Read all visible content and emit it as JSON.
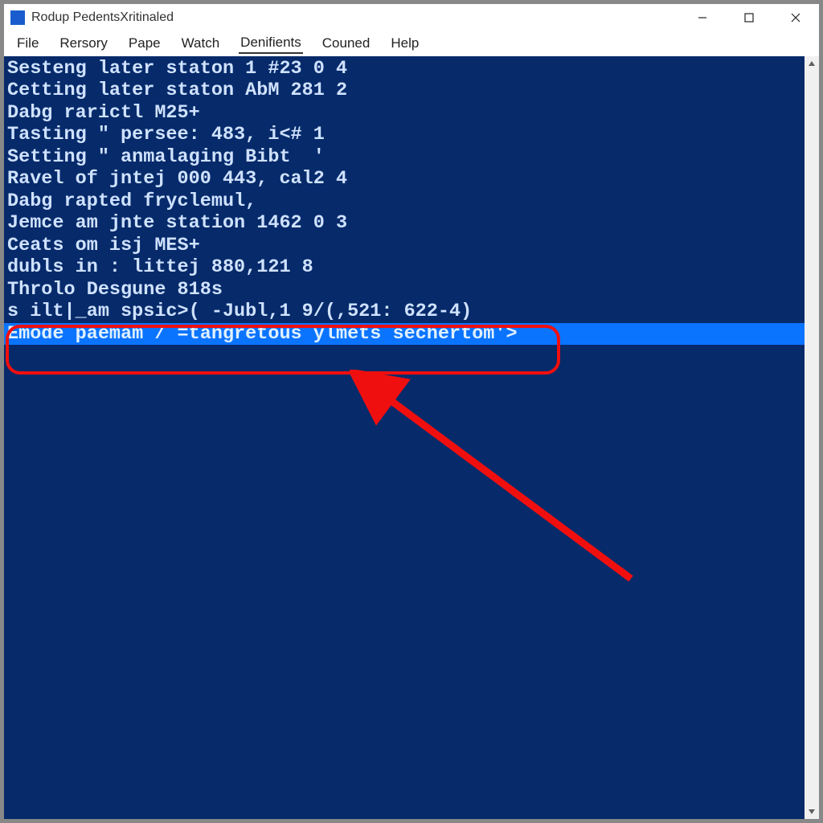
{
  "titlebar": {
    "text": "Rodup PedentsXritinaled"
  },
  "menu": {
    "items": [
      {
        "label": "File",
        "active": false
      },
      {
        "label": "Rersory",
        "active": false
      },
      {
        "label": "Pape",
        "active": false
      },
      {
        "label": "Watch",
        "active": false
      },
      {
        "label": "Denifients",
        "active": true
      },
      {
        "label": "Couned",
        "active": false
      },
      {
        "label": "Help",
        "active": false
      }
    ]
  },
  "terminal": {
    "lines": [
      {
        "text": "Sesteng later staton 1 #23 0 4",
        "hl": false
      },
      {
        "text": "Cetting later staton AbM 281 2",
        "hl": false
      },
      {
        "text": "Dabg rarictl M25+",
        "hl": false
      },
      {
        "text": "Tasting \" persee: 483, i<# 1",
        "hl": false
      },
      {
        "text": "Setting \" anmalaging Bibt  '",
        "hl": false
      },
      {
        "text": "Ravel of jntej 000 443, cal2 4",
        "hl": false
      },
      {
        "text": "Dabg rapted fryclemul,",
        "hl": false
      },
      {
        "text": "",
        "hl": false
      },
      {
        "text": "Jemce am jnte station 1462 0 3",
        "hl": false
      },
      {
        "text": "Ceats om isj MES+",
        "hl": false
      },
      {
        "text": "dubls in : littej 880,121 8",
        "hl": false
      },
      {
        "text": "Throlo Desgune 818s",
        "hl": false
      },
      {
        "text": "s ilt|_am spsic>( -Jubl,1 9/(,521: 622-4)",
        "hl": false
      },
      {
        "text": "Emode paemam / =tangretous ylmets sechertom'>",
        "hl": true
      }
    ]
  }
}
